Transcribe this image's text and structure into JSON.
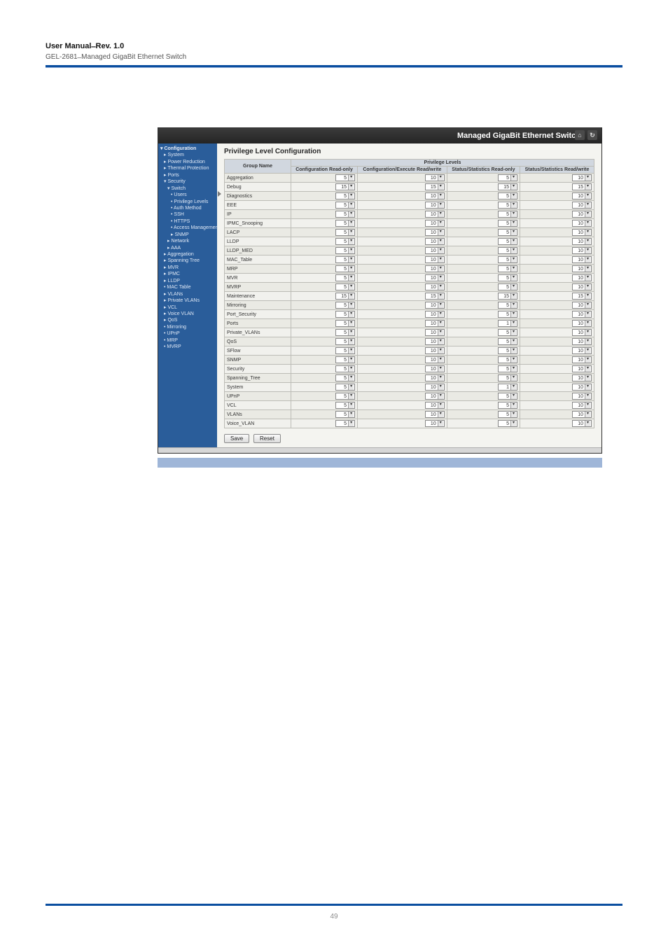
{
  "doc": {
    "title_main": "User Manual  ̶  Rev. 1.0",
    "title_sub": "GEL-2681  ̶  Managed GigaBit Ethernet Switch"
  },
  "shot_header": {
    "title": "Managed GigaBit Ethernet Switch"
  },
  "sidebar": [
    {
      "t": "▾ Configuration",
      "c": "lvl0"
    },
    {
      "t": "▸ System",
      "c": "lvl1"
    },
    {
      "t": "▸ Power Reduction",
      "c": "lvl1"
    },
    {
      "t": "▸ Thermal Protection",
      "c": "lvl1"
    },
    {
      "t": "▸ Ports",
      "c": "lvl1"
    },
    {
      "t": "▾ Security",
      "c": "lvl1"
    },
    {
      "t": "▾ Switch",
      "c": "lvl2"
    },
    {
      "t": "• Users",
      "c": "lvl3"
    },
    {
      "t": "• Privilege Levels",
      "c": "lvl3"
    },
    {
      "t": "• Auth Method",
      "c": "lvl3"
    },
    {
      "t": "• SSH",
      "c": "lvl3"
    },
    {
      "t": "• HTTPS",
      "c": "lvl3"
    },
    {
      "t": "• Access Management",
      "c": "lvl3"
    },
    {
      "t": "▸ SNMP",
      "c": "lvl3"
    },
    {
      "t": "▸ Network",
      "c": "lvl2"
    },
    {
      "t": "▸ AAA",
      "c": "lvl2"
    },
    {
      "t": "▸ Aggregation",
      "c": "lvl1"
    },
    {
      "t": "▸ Spanning Tree",
      "c": "lvl1"
    },
    {
      "t": "▸ MVR",
      "c": "lvl1"
    },
    {
      "t": "▸ IPMC",
      "c": "lvl1"
    },
    {
      "t": "▸ LLDP",
      "c": "lvl1"
    },
    {
      "t": "• MAC Table",
      "c": "lvl1"
    },
    {
      "t": "▸ VLANs",
      "c": "lvl1"
    },
    {
      "t": "▸ Private VLANs",
      "c": "lvl1"
    },
    {
      "t": "▸ VCL",
      "c": "lvl1"
    },
    {
      "t": "▸ Voice VLAN",
      "c": "lvl1"
    },
    {
      "t": "▸ QoS",
      "c": "lvl1"
    },
    {
      "t": "• Mirroring",
      "c": "lvl1"
    },
    {
      "t": "• UPnP",
      "c": "lvl1"
    },
    {
      "t": "• MRP",
      "c": "lvl1"
    },
    {
      "t": "• MVRP",
      "c": "lvl1"
    }
  ],
  "content": {
    "heading": "Privilege Level Configuration",
    "super_header": "Privilege Levels",
    "cols": [
      "Group Name",
      "Configuration Read-only",
      "Configuration/Execute Read/write",
      "Status/Statistics Read-only",
      "Status/Statistics Read/write"
    ],
    "rows": [
      {
        "name": "Aggregation",
        "v": [
          5,
          10,
          5,
          10
        ]
      },
      {
        "name": "Debug",
        "v": [
          15,
          15,
          15,
          15
        ]
      },
      {
        "name": "Diagnostics",
        "v": [
          5,
          10,
          5,
          10
        ]
      },
      {
        "name": "EEE",
        "v": [
          5,
          10,
          5,
          10
        ]
      },
      {
        "name": "IP",
        "v": [
          5,
          10,
          5,
          10
        ]
      },
      {
        "name": "IPMC_Snooping",
        "v": [
          5,
          10,
          5,
          10
        ]
      },
      {
        "name": "LACP",
        "v": [
          5,
          10,
          5,
          10
        ]
      },
      {
        "name": "LLDP",
        "v": [
          5,
          10,
          5,
          10
        ]
      },
      {
        "name": "LLDP_MED",
        "v": [
          5,
          10,
          5,
          10
        ]
      },
      {
        "name": "MAC_Table",
        "v": [
          5,
          10,
          5,
          10
        ]
      },
      {
        "name": "MRP",
        "v": [
          5,
          10,
          5,
          10
        ]
      },
      {
        "name": "MVR",
        "v": [
          5,
          10,
          5,
          10
        ]
      },
      {
        "name": "MVRP",
        "v": [
          5,
          10,
          5,
          10
        ]
      },
      {
        "name": "Maintenance",
        "v": [
          15,
          15,
          15,
          15
        ]
      },
      {
        "name": "Mirroring",
        "v": [
          5,
          10,
          5,
          10
        ]
      },
      {
        "name": "Port_Security",
        "v": [
          5,
          10,
          5,
          10
        ]
      },
      {
        "name": "Ports",
        "v": [
          5,
          10,
          1,
          10
        ]
      },
      {
        "name": "Private_VLANs",
        "v": [
          5,
          10,
          5,
          10
        ]
      },
      {
        "name": "QoS",
        "v": [
          5,
          10,
          5,
          10
        ]
      },
      {
        "name": "SFlow",
        "v": [
          5,
          10,
          5,
          10
        ]
      },
      {
        "name": "SNMP",
        "v": [
          5,
          10,
          5,
          10
        ]
      },
      {
        "name": "Security",
        "v": [
          5,
          10,
          5,
          10
        ]
      },
      {
        "name": "Spanning_Tree",
        "v": [
          5,
          10,
          5,
          10
        ]
      },
      {
        "name": "System",
        "v": [
          5,
          10,
          1,
          10
        ]
      },
      {
        "name": "UPnP",
        "v": [
          5,
          10,
          5,
          10
        ]
      },
      {
        "name": "VCL",
        "v": [
          5,
          10,
          5,
          10
        ]
      },
      {
        "name": "VLANs",
        "v": [
          5,
          10,
          5,
          10
        ]
      },
      {
        "name": "Voice_VLAN",
        "v": [
          5,
          10,
          5,
          10
        ]
      }
    ],
    "buttons": {
      "save": "Save",
      "reset": "Reset"
    }
  },
  "footer": {
    "page": "49",
    "total": ""
  }
}
